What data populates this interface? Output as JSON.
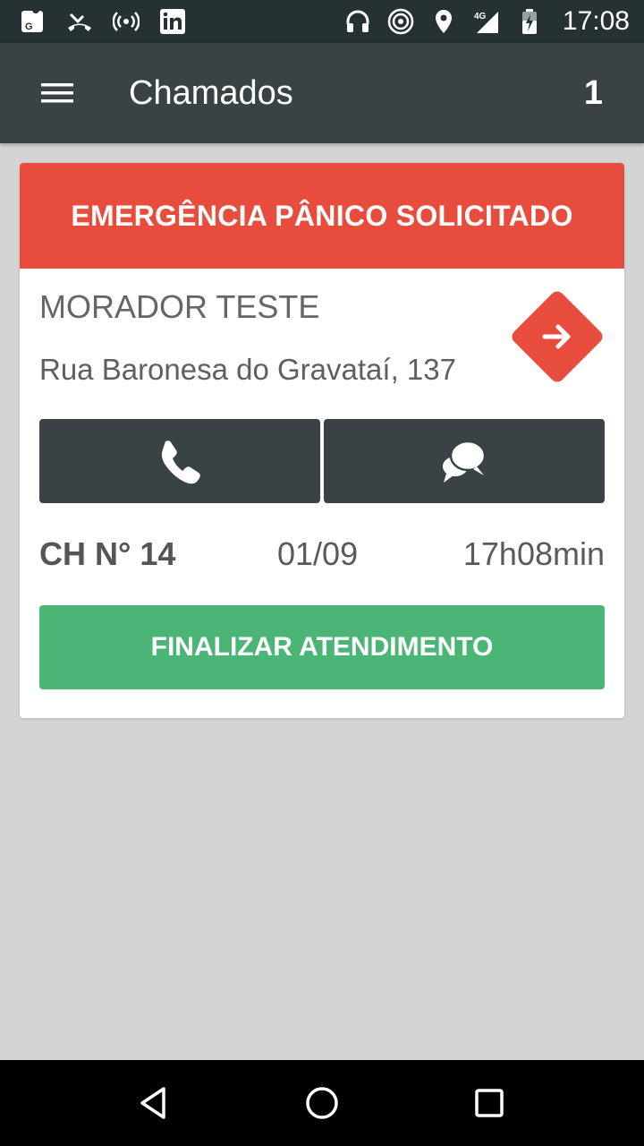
{
  "status_bar": {
    "time": "17:08",
    "left_icons": [
      "maps-icon",
      "missed-call-icon",
      "hotspot-icon",
      "linkedin-icon"
    ],
    "right_icons": [
      "headset-icon",
      "cast-icon",
      "location-icon",
      "signal-4g-icon",
      "battery-charging-icon"
    ]
  },
  "app_bar": {
    "title": "Chamados",
    "count": "1"
  },
  "card": {
    "header": "EMERGÊNCIA PÂNICO SOLICITADO",
    "resident_name": "MORADOR TESTE",
    "address": "Rua Baronesa do Gravataí, 137",
    "call_number": "CH N° 14",
    "date": "01/09",
    "time": "17h08min",
    "finish_label": "FINALIZAR ATENDIMENTO"
  },
  "colors": {
    "emergency_red": "#e74c3c",
    "finish_green": "#4ab574",
    "dark_button": "#394346",
    "app_bar": "#394346",
    "status_bar": "#263133"
  }
}
